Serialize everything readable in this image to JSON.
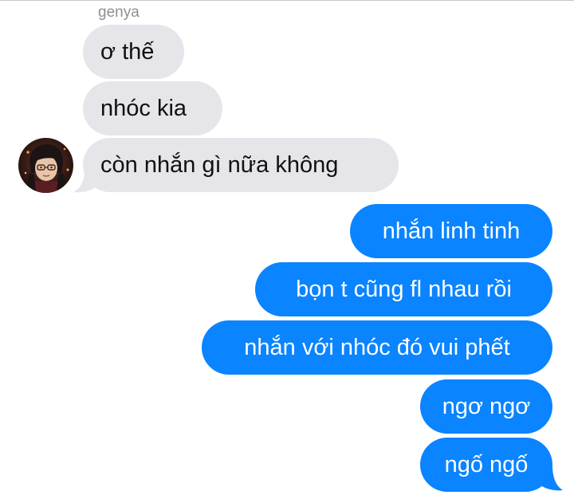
{
  "conversation": {
    "sender_name": "genya",
    "incoming": [
      {
        "text": "ơ thế"
      },
      {
        "text": "nhóc kia"
      },
      {
        "text": "còn nhắn gì nữa không"
      }
    ],
    "outgoing": [
      {
        "text": "nhắn linh tinh"
      },
      {
        "text": "bọn t cũng fl nhau rồi"
      },
      {
        "text": "nhắn với nhóc đó vui phết"
      },
      {
        "text": "ngơ ngơ"
      },
      {
        "text": "ngố ngố"
      }
    ]
  },
  "colors": {
    "incoming_bubble": "#e5e5ea",
    "outgoing_bubble": "#0a84ff",
    "sender_name": "#8e8e93"
  },
  "icons": {
    "avatar": "avatar-illustration"
  }
}
